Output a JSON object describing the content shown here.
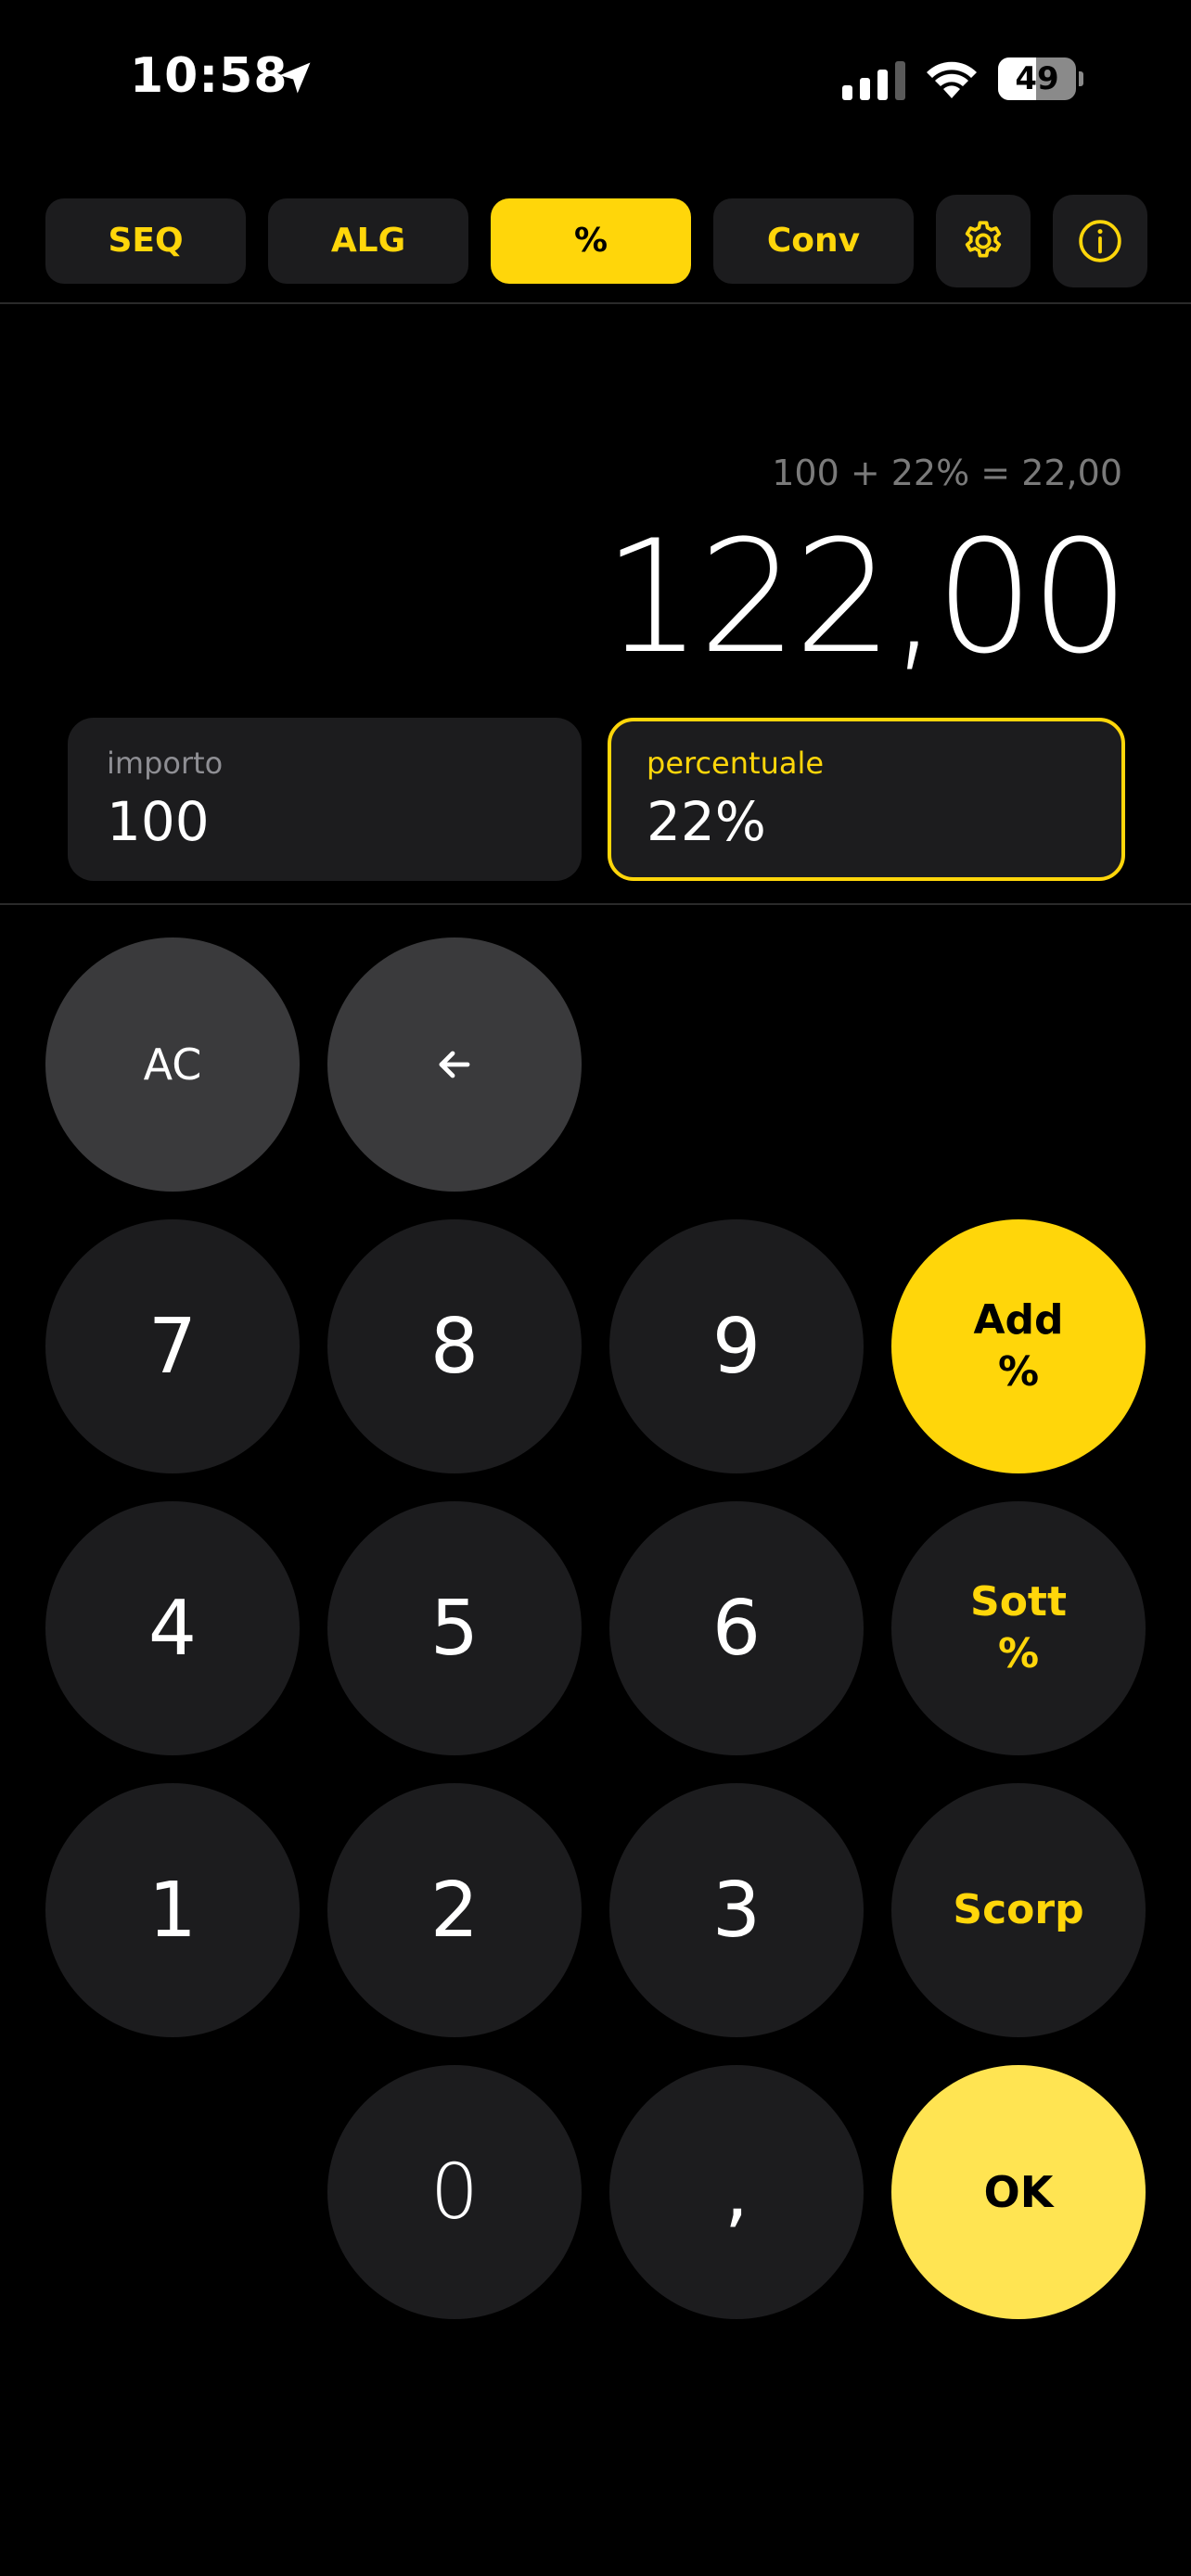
{
  "status_bar": {
    "time": "10:58",
    "battery_level": "49",
    "battery_fraction": 0.49
  },
  "tabs": [
    {
      "label": "SEQ",
      "active": false
    },
    {
      "label": "ALG",
      "active": false
    },
    {
      "label": "%",
      "active": true
    },
    {
      "label": "Conv",
      "active": false
    }
  ],
  "icon_buttons": {
    "settings": "gear-icon",
    "info": "info-icon"
  },
  "display": {
    "expression": "100 + 22% = 22,00",
    "result": "122,00"
  },
  "fields": {
    "amount": {
      "label": "importo",
      "value": "100"
    },
    "percent": {
      "label": "percentuale",
      "value": "22%"
    }
  },
  "keys": {
    "clear": "AC",
    "backspace_icon": "arrow-left-icon",
    "seven": "7",
    "eight": "8",
    "nine": "9",
    "add_pct_line1": "Add",
    "add_pct_line2": "%",
    "four": "4",
    "five": "5",
    "six": "6",
    "sub_pct_line1": "Sott",
    "sub_pct_line2": "%",
    "one": "1",
    "two": "2",
    "three": "3",
    "discount": "Scorp",
    "zero": "0",
    "decimal": ",",
    "ok": "OK"
  },
  "colors": {
    "accent": "#ffd60a",
    "ok_key": "#ffe452",
    "key_dark": "#1c1c1e",
    "key_gray": "#3a3a3c",
    "background": "#000000"
  }
}
